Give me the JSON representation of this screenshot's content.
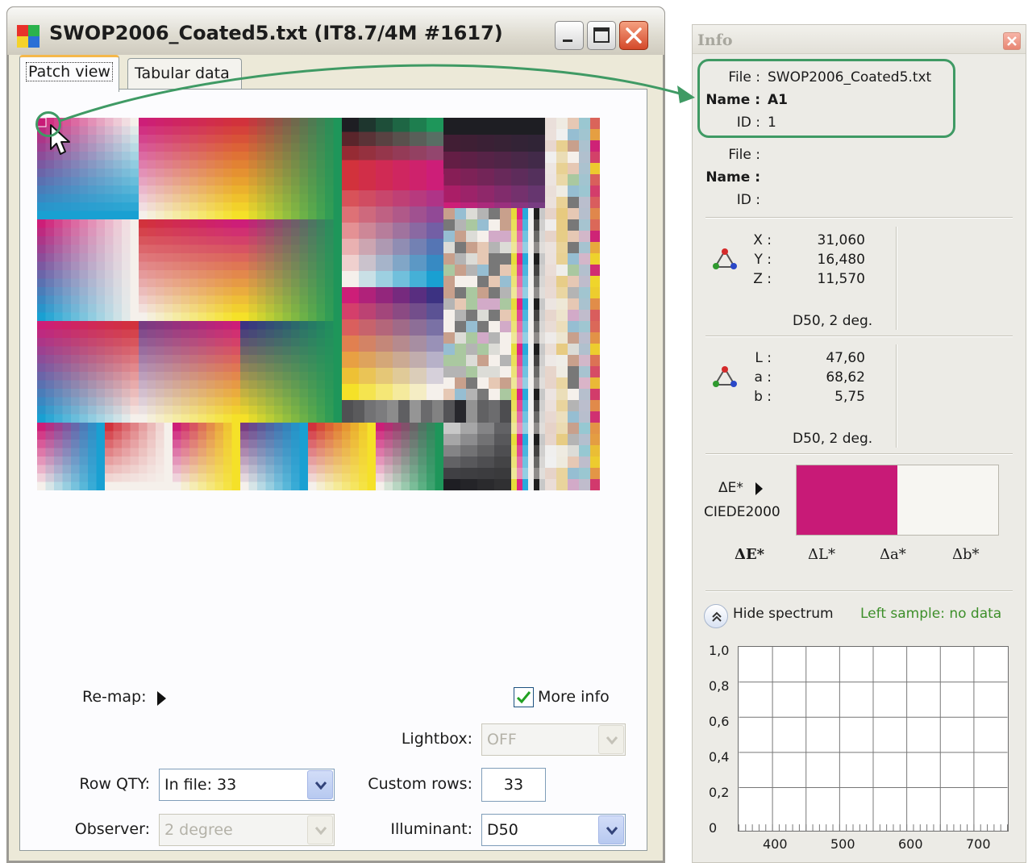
{
  "window": {
    "title": "SWOP2006_Coated5.txt (IT8.7/4M #1617)",
    "tabs": [
      "Patch view",
      "Tabular data"
    ]
  },
  "controls": {
    "remap_label": "Re-map:",
    "more_info_label": "More info",
    "more_info_checked": true,
    "lightbox_label": "Lightbox:",
    "lightbox_value": "OFF",
    "row_qty_label": "Row QTY:",
    "row_qty_value": "In file: 33",
    "custom_rows_label": "Custom rows:",
    "custom_rows_value": "33",
    "observer_label": "Observer:",
    "observer_value": "2 degree",
    "illuminant_label": "Illuminant:",
    "illuminant_value": "D50"
  },
  "info": {
    "title": "Info",
    "sample1": {
      "file_label": "File :",
      "file_value": "SWOP2006_Coated5.txt",
      "name_label": "Name :",
      "name_value": "A1",
      "id_label": "ID :",
      "id_value": "1"
    },
    "sample2": {
      "file_label": "File :",
      "name_label": "Name :",
      "id_label": "ID :"
    },
    "xyz": {
      "labels": [
        "X :",
        "Y :",
        "Z :"
      ],
      "values": [
        "31,060",
        "16,480",
        "11,570"
      ],
      "illuminant": "D50, 2 deg."
    },
    "lab": {
      "labels": [
        "L :",
        "a :",
        "b :"
      ],
      "values": [
        "47,60",
        "68,62",
        "5,75"
      ],
      "illuminant": "D50, 2 deg."
    },
    "delta": {
      "label": "ΔE*",
      "formula": "CIEDE2000",
      "swatch_color": "#c81a77",
      "metrics": [
        "ΔE*",
        "ΔL*",
        "Δa*",
        "Δb*"
      ]
    },
    "spectrum": {
      "toggle_label": "Hide spectrum",
      "status": "Left sample: no data",
      "y_ticks": [
        "1,0",
        "0,8",
        "0,6",
        "0,4",
        "0,2",
        "0"
      ],
      "x_ticks": [
        "400",
        "500",
        "600",
        "700"
      ]
    }
  },
  "colors": {
    "accent_green": "#3f9a64",
    "sample_magenta": "#c81a77",
    "status_green": "#3d8f2a"
  },
  "icons": [
    "app-icon",
    "minimize-icon",
    "maximize-icon",
    "close-icon",
    "mouse-cursor-icon",
    "dropdown-arrow-icon",
    "checkmark-icon",
    "colorimetry-triangle-icon",
    "collapse-up-icon",
    "remap-arrow-icon"
  ]
}
